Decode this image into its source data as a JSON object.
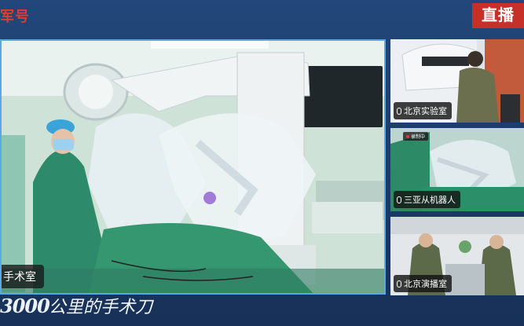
{
  "header": {
    "logo_text": "军号",
    "live_badge": "直播"
  },
  "main_feed": {
    "label": "手术室"
  },
  "side_feeds": [
    {
      "label": "北京实验室"
    },
    {
      "label": "三亚从机器人",
      "rec_text": "录制中"
    },
    {
      "label": "北京演播室"
    }
  ],
  "banner": {
    "number": "3000",
    "script": "公里的手术刀"
  },
  "colors": {
    "accent": "#5aa8e6",
    "live": "#c63028",
    "background": "#1f3f6e"
  }
}
